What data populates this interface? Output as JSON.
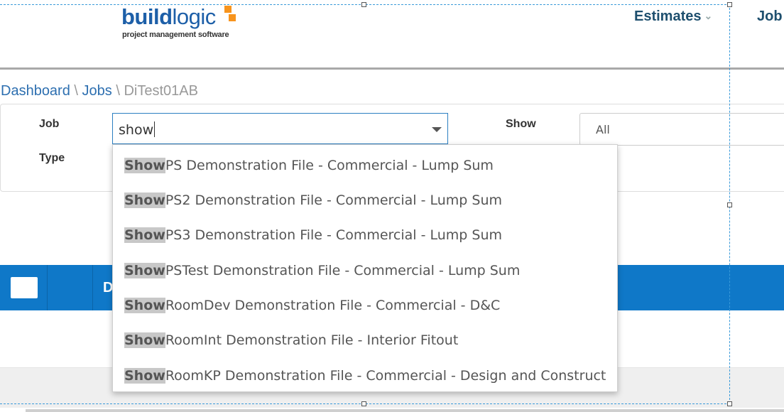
{
  "header": {
    "logo": {
      "word_build": "build",
      "word_logic": "logic",
      "tagline": "project management software"
    },
    "nav": {
      "estimates": "Estimates",
      "jobs": "Job"
    }
  },
  "breadcrumb": {
    "items": [
      "Dashboard",
      "Jobs"
    ],
    "separator": "\\",
    "current": "DiTest01AB"
  },
  "filters": {
    "job_label": "Job",
    "job_value": "show",
    "type_label": "Type",
    "show_label": "Show",
    "show_value": "All"
  },
  "table": {
    "header_partial": "D"
  },
  "dropdown": {
    "match": "Show",
    "items": [
      "PS Demonstration File - Commercial - Lump Sum",
      "PS2 Demonstration File - Commercial - Lump Sum",
      "PS3 Demonstration File - Commercial - Lump Sum",
      "PSTest Demonstration File - Commercial - Lump Sum",
      "RoomDev Demonstration File - Commercial - D&C",
      "RoomInt Demonstration File - Interior Fitout",
      "RoomKP Demonstration File - Commercial - Design and Construct"
    ]
  },
  "colors": {
    "brand_blue": "#1d5fa8",
    "accent_orange": "#f7941d",
    "nav_text": "#1e4f6e",
    "table_header": "#0f78c8",
    "link": "#2d6fb0"
  }
}
